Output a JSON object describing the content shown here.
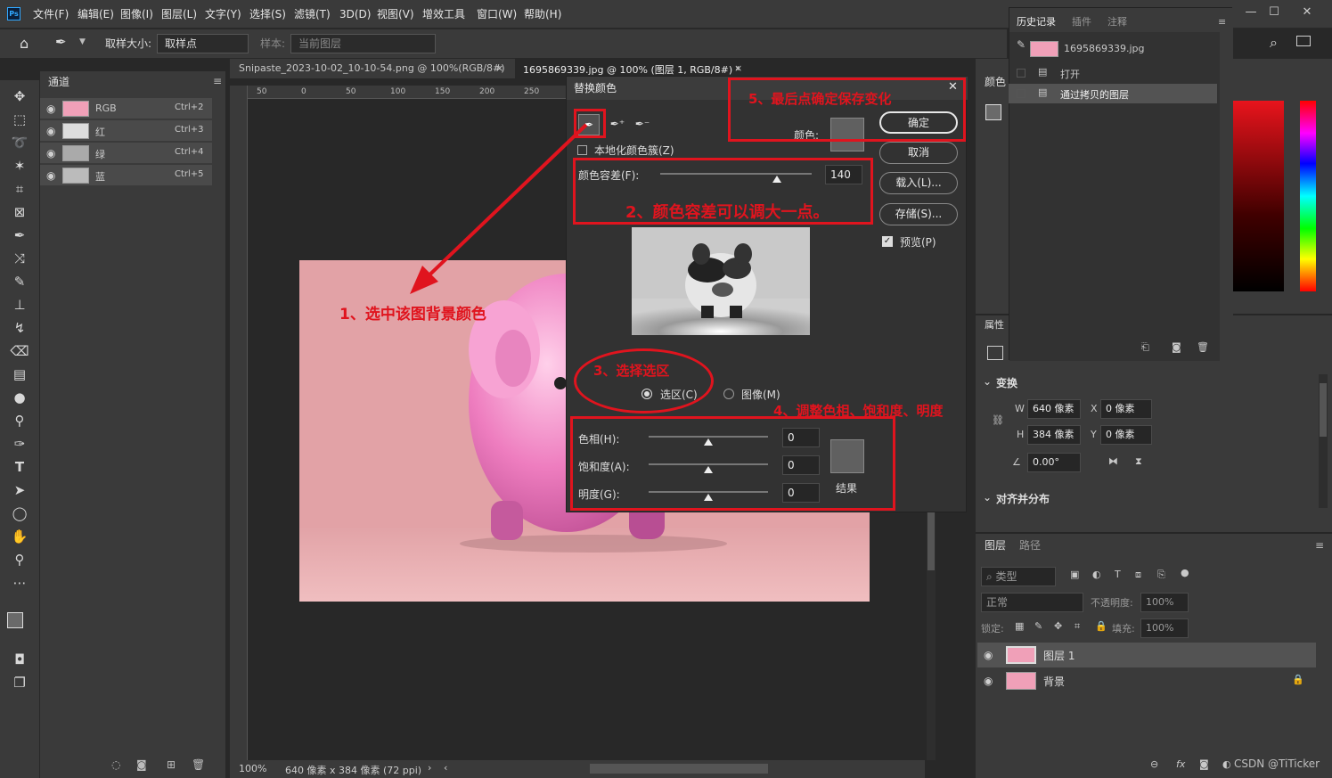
{
  "menu": [
    "文件(F)",
    "编辑(E)",
    "图像(I)",
    "图层(L)",
    "文字(Y)",
    "选择(S)",
    "滤镜(T)",
    "3D(D)",
    "视图(V)",
    "增效工具",
    "窗口(W)",
    "帮助(H)"
  ],
  "options": {
    "sample_size_label": "取样大小:",
    "sample_size_value": "取样点",
    "sample_label": "样本:",
    "sample_value": "当前图层"
  },
  "tabs": [
    {
      "label": "Snipaste_2023-10-02_10-10-54.png @ 100%(RGB/8#)",
      "close": "×"
    },
    {
      "label": "1695869339.jpg @ 100% (图层 1, RGB/8#) *",
      "close": "×"
    }
  ],
  "channels": {
    "title": "通道",
    "rows": [
      {
        "name": "RGB",
        "key": "Ctrl+2"
      },
      {
        "name": "红",
        "key": "Ctrl+3"
      },
      {
        "name": "绿",
        "key": "Ctrl+4"
      },
      {
        "name": "蓝",
        "key": "Ctrl+5"
      }
    ]
  },
  "ruler": [
    "50",
    "0",
    "50",
    "100",
    "150",
    "200",
    "250"
  ],
  "dialog": {
    "title": "替换颜色",
    "close": "✕",
    "localized": "本地化颜色簇(Z)",
    "color_label": "颜色:",
    "ok": "确定",
    "cancel": "取消",
    "load": "载入(L)...",
    "save": "存储(S)...",
    "preview": "预览(P)",
    "fuzziness_label": "颜色容差(F):",
    "fuzziness_value": "140",
    "fuzziness_pct": 0.77,
    "radio_selection": "选区(C)",
    "radio_image": "图像(M)",
    "hue_label": "色相(H):",
    "hue": "0",
    "sat_label": "饱和度(A):",
    "sat": "0",
    "light_label": "明度(G):",
    "light": "0",
    "result_label": "结果"
  },
  "annotations": {
    "a1": "1、选中该图背景颜色",
    "a2": "2、颜色容差可以调大一点。",
    "a3": "3、选择选区",
    "a4": "4、调整色相、饱和度、明度",
    "a5": "5、最后点确定保存变化"
  },
  "status": {
    "zoom": "100%",
    "size": "640 像素 x 384 像素 (72 ppi)"
  },
  "history": {
    "tabs": [
      "历史记录",
      "插件",
      "注释"
    ],
    "snapshot": "1695869339.jpg",
    "items": [
      "打开",
      "通过拷贝的图层"
    ]
  },
  "color_panel": {
    "title": "颜色"
  },
  "properties": {
    "title": "属性",
    "transform": "变换",
    "w_label": "W",
    "w": "640 像素",
    "h_label": "H",
    "h": "384 像素",
    "x_label": "X",
    "x": "0 像素",
    "y_label": "Y",
    "y": "0 像素",
    "angle": "0.00°",
    "align": "对齐并分布"
  },
  "layers": {
    "tabs": [
      "图层",
      "路径"
    ],
    "kind": "类型",
    "blend": "正常",
    "opacity_label": "不透明度:",
    "opacity": "100%",
    "lock_label": "锁定:",
    "fill_label": "填充:",
    "fill": "100%",
    "items": [
      "图层 1",
      "背景"
    ]
  },
  "watermark": "CSDN @TiTicker"
}
